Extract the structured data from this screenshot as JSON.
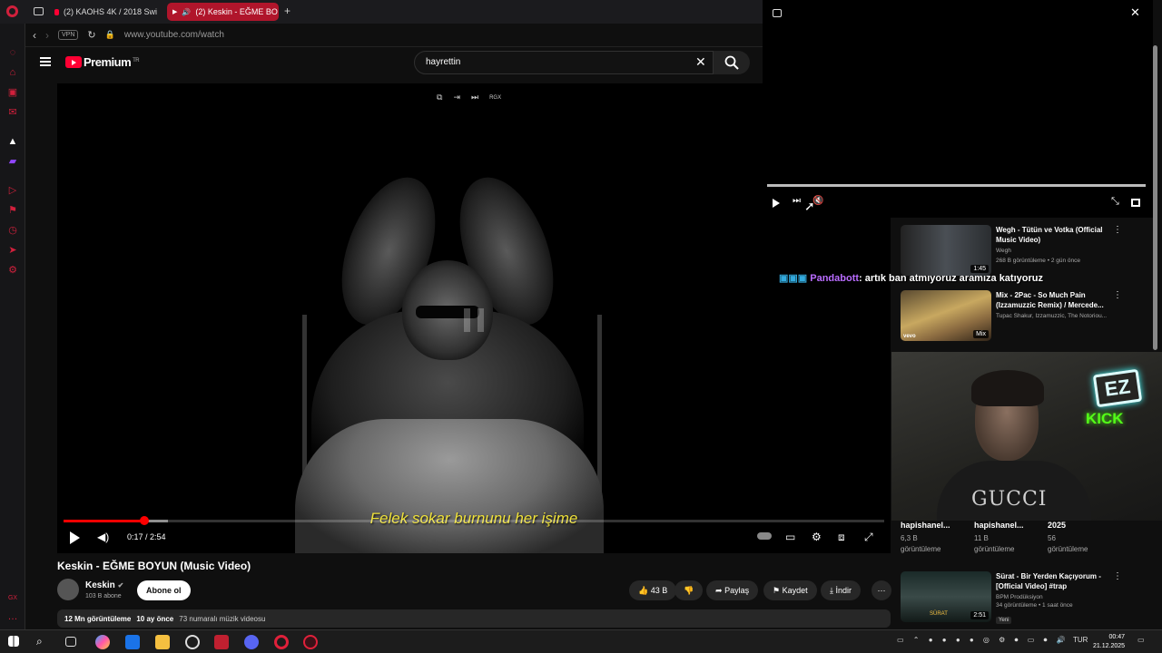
{
  "tabs": [
    {
      "label": "(2) KAOHS 4K / 2018 Swi"
    },
    {
      "label": "(2) Keskin - EĞME BO"
    }
  ],
  "address": {
    "vpn": "VPN",
    "url": "www.youtube.com/watch"
  },
  "header": {
    "brand": "Premium",
    "region": "TR",
    "search_value": "hayrettin"
  },
  "player": {
    "top_controls": [
      "⧉",
      "⇥",
      "⏭",
      "RGX"
    ],
    "subtitle": "Felek sokar burnunu her işime",
    "time": "0:17 / 2:54",
    "progress_played": 0.098,
    "progress_buffered": 0.127
  },
  "video": {
    "title": "Keskin - EĞME BOYUN (Music Video)",
    "channel": "Keskin",
    "subscribers": "103 B abone",
    "subscribe_label": "Abone ol",
    "likes": "43 B",
    "share_label": "Paylaş",
    "save_label": "Kaydet",
    "download_label": "İndir",
    "views": "12 Mn görüntüleme",
    "age": "10 ay önce",
    "tagline": "73 numaralı müzik videosu"
  },
  "recs": [
    {
      "title": "Wegh - Tütün ve Votka (Official Music Video)",
      "channel": "Wegh",
      "meta": "268 B görüntüleme • 2 gün önce",
      "duration": "1:45"
    },
    {
      "title": "Mix - 2Pac - So Much Pain (Izzamuzzic Remix) / Mercede...",
      "channel": "Tupac Shakur, Izzamuzzic, The Notoriou...",
      "meta": "",
      "duration": "Mix"
    }
  ],
  "chat": {
    "user": "Pandabott",
    "message": ": artık ban atmıyoruz aramıza katıyoruz"
  },
  "webcam": {
    "shirt_text": "GUCCI",
    "sign_top": "EZ",
    "sign_bottom": "KICK"
  },
  "stats": [
    {
      "head": "hapishanel...",
      "num": "6,3 B",
      "label": "görüntüleme"
    },
    {
      "head": "hapishanel...",
      "num": "11 B",
      "label": "görüntüleme"
    },
    {
      "head": "2025",
      "num": "56",
      "label": "görüntüleme"
    }
  ],
  "rec3": {
    "title": "Sürat - Bir Yerden Kaçıyorum - [Official Video] #trap",
    "channel": "BPM Prodüksiyon",
    "meta": "34 görüntüleme • 1 saat önce",
    "badge": "Yeni",
    "duration": "2:51",
    "thumb_text": "SÜRAT"
  },
  "taskbar": {
    "lang": "TUR",
    "time": "00:47",
    "date": "21.12.2025"
  },
  "colors": {
    "accent": "#ff0033",
    "opera": "#d1203c",
    "subtitle": "#f0e23a",
    "kick": "#53fc18"
  }
}
